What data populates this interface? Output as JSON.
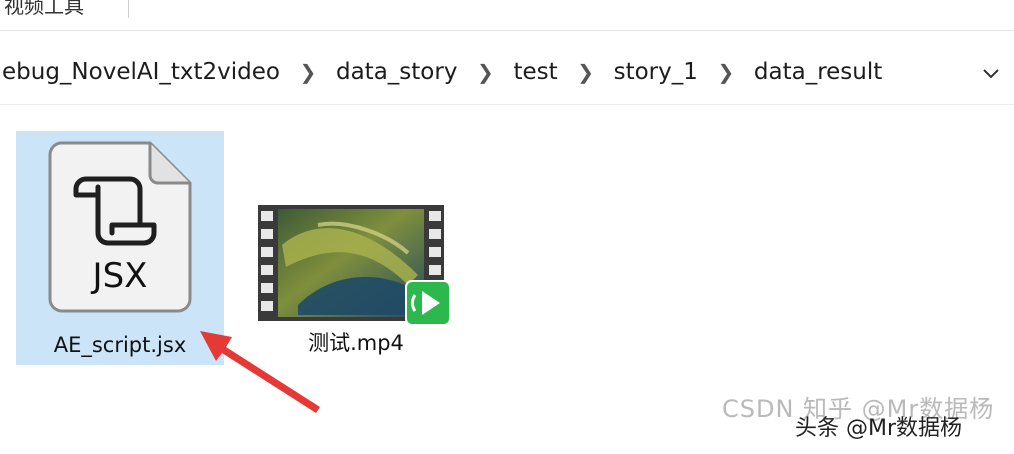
{
  "toolbar": {
    "partial_label": "视频工具"
  },
  "address_bar": {
    "crumbs": [
      "ebug_NovelAI_txt2video",
      "data_story",
      "test",
      "story_1",
      "data_result"
    ]
  },
  "files": [
    {
      "name": "AE_script.jsx",
      "icon_text": "JSX",
      "icon": "jsx-file-icon",
      "selected": true
    },
    {
      "name": "测试.mp4",
      "icon": "video-file-icon",
      "selected": false
    }
  ],
  "watermarks": {
    "light": "CSDN  知乎 @Mr数据杨",
    "dark": "头条 @Mr数据杨"
  },
  "colors": {
    "selection": "#cce4f7",
    "arrow": "#e53935",
    "badge": "#2db84d"
  }
}
